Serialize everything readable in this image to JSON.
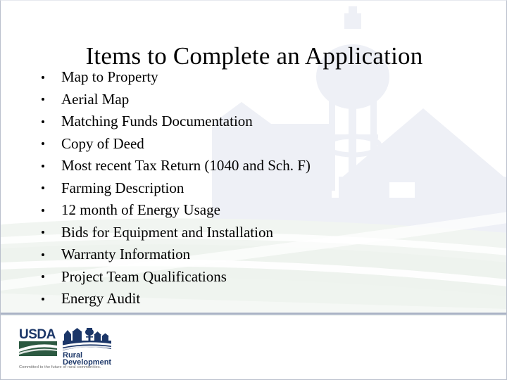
{
  "slide": {
    "title": "Items to Complete an Application",
    "bullets": [
      "Map to Property",
      "Aerial Map",
      "Matching Funds Documentation",
      "Copy of Deed",
      "Most recent Tax Return (1040 and Sch. F)",
      "Farming Description",
      "12 month of Energy Usage",
      "Bids for Equipment and Installation",
      "Warranty Information",
      "Project Team Qualifications",
      "Energy Audit"
    ]
  },
  "logo": {
    "agency": "USDA",
    "program_line1": "Rural",
    "program_line2": "Development",
    "tagline": "Committed to the future of rural communities.",
    "colors": {
      "navy": "#1b3668",
      "green": "#2c5941",
      "tagline_gray": "#6b6b6b"
    }
  },
  "background": {
    "motifs": [
      "water-tower",
      "barn",
      "house",
      "rolling-fields"
    ],
    "colors": {
      "building_tint": "#eef0f6",
      "field_tint": "#eef3ee",
      "page": "#ffffff",
      "divider": "#a9b2c4"
    }
  }
}
